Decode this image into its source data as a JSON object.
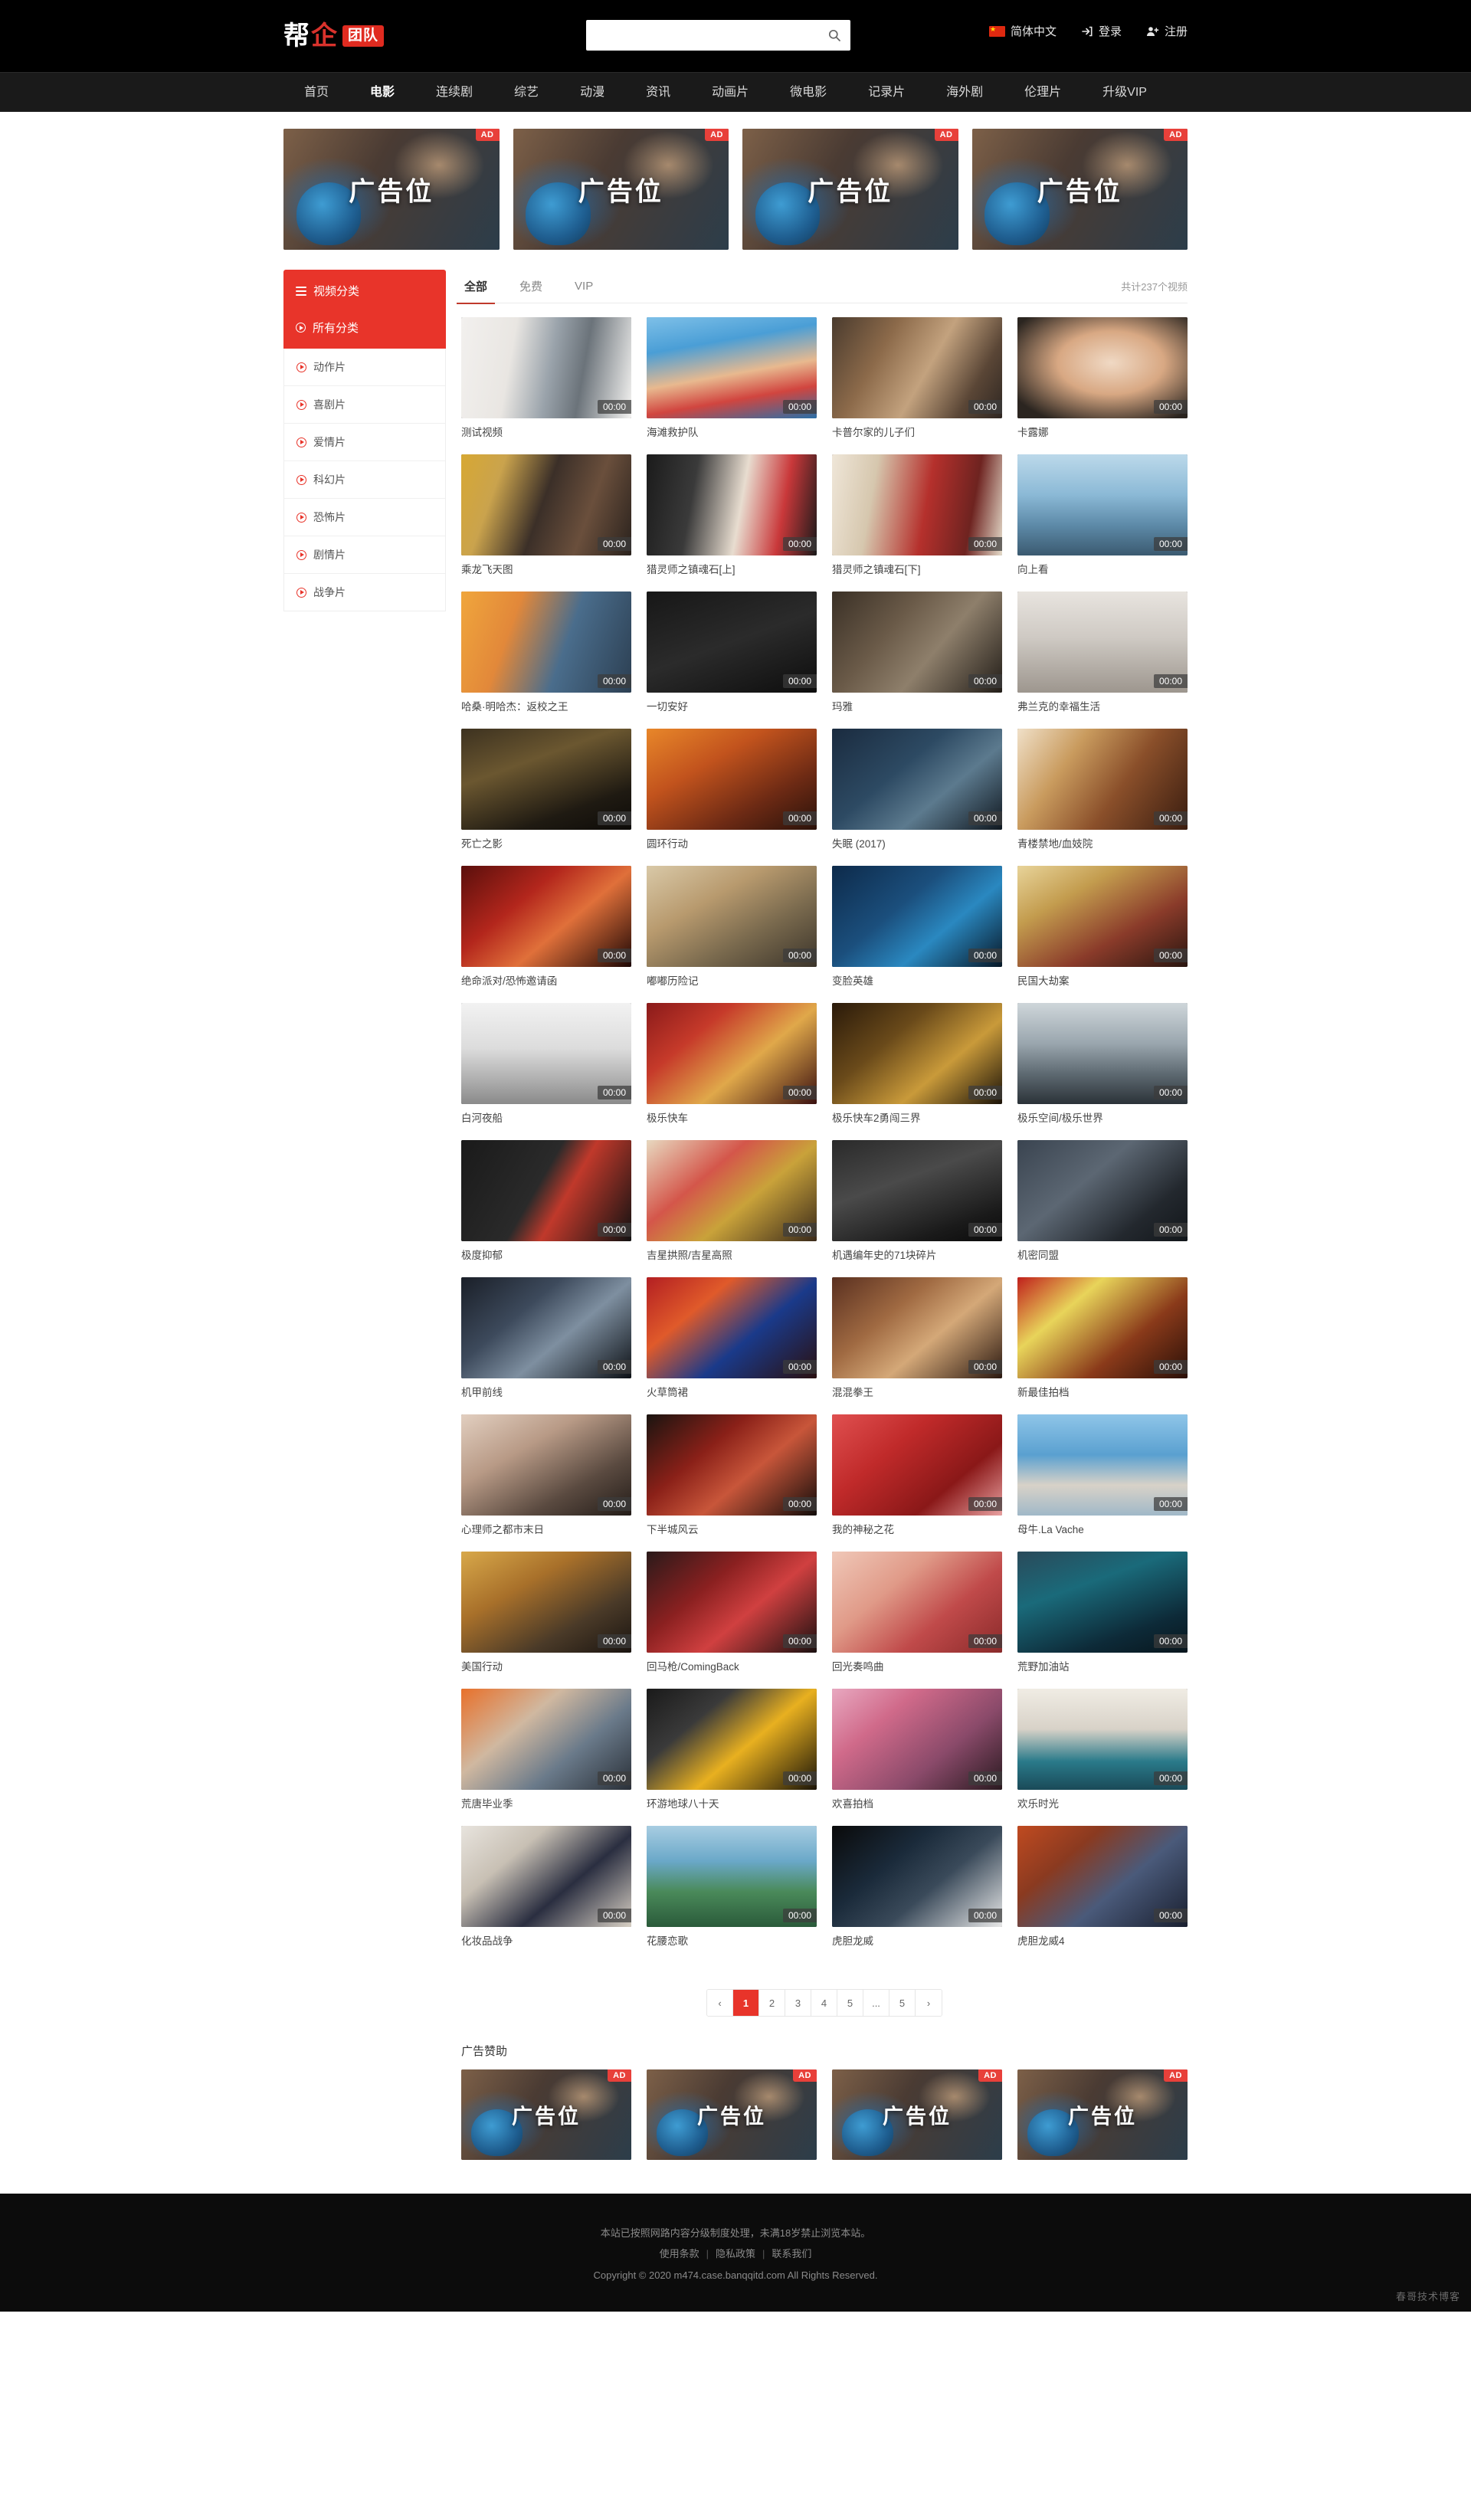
{
  "header": {
    "logo": {
      "part1": "帮",
      "part2": "企",
      "badge": "团队"
    },
    "search": {
      "value": "",
      "placeholder": ""
    },
    "language": "简体中文",
    "login": "登录",
    "register": "注册"
  },
  "nav": {
    "items": [
      {
        "label": "首页",
        "active": false
      },
      {
        "label": "电影",
        "active": true
      },
      {
        "label": "连续剧",
        "active": false
      },
      {
        "label": "综艺",
        "active": false
      },
      {
        "label": "动漫",
        "active": false
      },
      {
        "label": "资讯",
        "active": false
      },
      {
        "label": "动画片",
        "active": false
      },
      {
        "label": "微电影",
        "active": false
      },
      {
        "label": "记录片",
        "active": false
      },
      {
        "label": "海外剧",
        "active": false
      },
      {
        "label": "伦理片",
        "active": false
      },
      {
        "label": "升级VIP",
        "active": false
      }
    ]
  },
  "top_ads": [
    {
      "badge": "AD",
      "text": "广告位"
    },
    {
      "badge": "AD",
      "text": "广告位"
    },
    {
      "badge": "AD",
      "text": "广告位"
    },
    {
      "badge": "AD",
      "text": "广告位"
    }
  ],
  "sidebar": {
    "title": "视频分类",
    "active_item": "所有分类",
    "items": [
      {
        "label": "动作片"
      },
      {
        "label": "喜剧片"
      },
      {
        "label": "爱情片"
      },
      {
        "label": "科幻片"
      },
      {
        "label": "恐怖片"
      },
      {
        "label": "剧情片"
      },
      {
        "label": "战争片"
      }
    ]
  },
  "filter": {
    "tabs": [
      {
        "label": "全部",
        "active": true
      },
      {
        "label": "免费",
        "active": false
      },
      {
        "label": "VIP",
        "active": false
      }
    ],
    "total": "共计237个视频"
  },
  "videos": [
    {
      "title": "测试视频",
      "duration": "00:00",
      "bg": "linear-gradient(100deg,#f2f0ee 0%,#e9e6e2 30%,#9aa3ab 52%,#6b737a 70%,#f4f3f1 100%)"
    },
    {
      "title": "海滩救护队",
      "duration": "00:00",
      "bg": "linear-gradient(170deg,#7ec0e8 0%,#4a9ed6 28%,#e8b98f 55%,#d1453f 75%,#2a6fa8 100%)"
    },
    {
      "title": "卡普尔家的儿子们",
      "duration": "00:00",
      "bg": "linear-gradient(120deg,#4a3b2e 0%,#8c6a4a 30%,#c3a27e 55%,#5a4636 80%,#2f2722 100%)"
    },
    {
      "title": "卡露娜",
      "duration": "00:00",
      "bg": "radial-gradient(ellipse at 55% 45%, #f0d9c4 0%, #d8a883 40%, #2b2520 85%)"
    },
    {
      "title": "乘龙飞天图",
      "duration": "00:00",
      "bg": "linear-gradient(110deg,#d7a833 0%,#caa34d 22%,#3b2f28 48%,#6a4f3c 72%,#2a221d 100%)"
    },
    {
      "title": "猎灵师之镇魂石[上]",
      "duration": "00:00",
      "bg": "linear-gradient(100deg,#1b1b1b 0%,#3a3a3a 28%,#e8ddd0 55%,#c9383a 78%,#1a1a1a 100%)"
    },
    {
      "title": "猎灵师之镇魂石[下]",
      "duration": "00:00",
      "bg": "linear-gradient(100deg,#efe6d8 0%,#d6c7ae 25%,#b5302c 55%,#6e2320 80%,#e5dccb 100%)"
    },
    {
      "title": "向上看",
      "duration": "00:00",
      "bg": "linear-gradient(180deg,#bcd9ea 0%,#8bb9d6 40%,#5d8aa8 70%,#3b5a70 100%)"
    },
    {
      "title": "哈桑·明哈杰：返校之王",
      "duration": "00:00",
      "bg": "linear-gradient(110deg,#f0a63c 0%,#e2883a 30%,#4a6d8c 60%,#2c3f52 100%)"
    },
    {
      "title": "一切安好",
      "duration": "00:00",
      "bg": "linear-gradient(160deg,#171717 0%,#2b2b2b 50%,#0d0d0d 100%)"
    },
    {
      "title": "玛雅",
      "duration": "00:00",
      "bg": "linear-gradient(130deg,#3a3026 0%,#6a5a48 35%,#8e7f6b 60%,#221d18 100%)"
    },
    {
      "title": "弗兰克的幸福生活",
      "duration": "00:00",
      "bg": "linear-gradient(180deg,#e8e4df 0%,#cfcac4 45%,#9d968e 100%)"
    },
    {
      "title": "死亡之影",
      "duration": "00:00",
      "bg": "linear-gradient(160deg,#3d3220 0%,#6b5730 35%,#1f1a12 75%,#0d0b08 100%)"
    },
    {
      "title": "圆环行动",
      "duration": "00:00",
      "bg": "linear-gradient(150deg,#e8872a 0%,#c2531d 35%,#6d2a14 70%,#2a120a 100%)"
    },
    {
      "title": "失眠 (2017)",
      "duration": "00:00",
      "bg": "linear-gradient(140deg,#1a2b3f 0%,#2d4a63 40%,#5c7a8e 65%,#101820 100%)"
    },
    {
      "title": "青楼禁地/血妓院",
      "duration": "00:00",
      "bg": "linear-gradient(125deg,#f0e0c8 0%,#c99b5e 30%,#8a4f2a 60%,#3a1d10 100%)"
    },
    {
      "title": "绝命派对/恐怖邀请函",
      "duration": "00:00",
      "bg": "linear-gradient(140deg,#5a0f0c 0%,#b3261c 35%,#e0703a 60%,#1d0705 100%)"
    },
    {
      "title": "嘟嘟历险记",
      "duration": "00:00",
      "bg": "linear-gradient(150deg,#d9c9a8 0%,#b89a6e 35%,#7a6a4e 65%,#3b342a 100%)"
    },
    {
      "title": "变脸英雄",
      "duration": "00:00",
      "bg": "linear-gradient(140deg,#0d2a4a 0%,#1b4f7d 40%,#2a88c0 65%,#081827 100%)"
    },
    {
      "title": "民国大劫案",
      "duration": "00:00",
      "bg": "linear-gradient(150deg,#e8d49a 0%,#c39c4e 30%,#8a3b2a 65%,#2a1610 100%)"
    },
    {
      "title": "白河夜船",
      "duration": "00:00",
      "bg": "linear-gradient(180deg,#f2f2f2 0%,#dcdcdc 45%,#b0b0b0 75%,#8a8a8a 100%)"
    },
    {
      "title": "极乐快车",
      "duration": "00:00",
      "bg": "linear-gradient(140deg,#8a1a1a 0%,#c63a2a 30%,#e0a84a 60%,#3a1010 100%)"
    },
    {
      "title": "极乐快车2勇闯三界",
      "duration": "00:00",
      "bg": "linear-gradient(140deg,#2a1a0a 0%,#6a4a1a 35%,#c99a3a 65%,#1a1208 100%)"
    },
    {
      "title": "极乐空间/极乐世界",
      "duration": "00:00",
      "bg": "linear-gradient(180deg,#cfd6da 0%,#9aa6ae 40%,#5e6a72 70%,#2b3238 100%)"
    },
    {
      "title": "极度抑郁",
      "duration": "00:00",
      "bg": "linear-gradient(120deg,#1a1a1a 0%,#2a2a2a 45%,#c0392b 60%,#121212 100%)"
    },
    {
      "title": "吉星拱照/吉星高照",
      "duration": "00:00",
      "bg": "linear-gradient(140deg,#e8d9c0 0%,#d4564a 35%,#c9a23a 60%,#3a2a1a 100%)"
    },
    {
      "title": "机遇编年史的71块碎片",
      "duration": "00:00",
      "bg": "linear-gradient(160deg,#2a2a2a 0%,#4a4a4a 40%,#1a1a1a 80%,#0a0a0a 100%)"
    },
    {
      "title": "机密同盟",
      "duration": "00:00",
      "bg": "linear-gradient(140deg,#3a4450 0%,#5c6773 40%,#23282e 75%,#12161a 100%)"
    },
    {
      "title": "机甲前线",
      "duration": "00:00",
      "bg": "linear-gradient(140deg,#1a1f28 0%,#3d4a5c 35%,#7e8fa0 60%,#0d1116 100%)"
    },
    {
      "title": "火草筒裙",
      "duration": "00:00",
      "bg": "linear-gradient(140deg,#b31f22 0%,#e05a2a 30%,#1a3a8a 60%,#2a1010 100%)"
    },
    {
      "title": "混混拳王",
      "duration": "00:00",
      "bg": "linear-gradient(140deg,#5a3020 0%,#a06a42 35%,#d4a878 60%,#2a1810 100%)"
    },
    {
      "title": "新最佳拍档",
      "duration": "00:00",
      "bg": "linear-gradient(140deg,#c0201c 0%,#e8d45a 30%,#8a3a1a 65%,#2a1008 100%)"
    },
    {
      "title": "心理师之都市末日",
      "duration": "00:00",
      "bg": "linear-gradient(150deg,#e2cfc0 0%,#b89a86 35%,#5a4a40 70%,#231c18 100%)"
    },
    {
      "title": "下半城风云",
      "duration": "00:00",
      "bg": "linear-gradient(140deg,#1a1410 0%,#8a2018 35%,#c8563a 60%,#120c0a 100%)"
    },
    {
      "title": "我的神秘之花",
      "duration": "00:00",
      "bg": "linear-gradient(140deg,#e05050 0%,#c02a2a 35%,#8a1818 70%,#e8a0a0 100%)"
    },
    {
      "title": "母牛.La Vache",
      "duration": "00:00",
      "bg": "linear-gradient(180deg,#8fc5e8 0%,#5aa0d0 40%,#d8d2c8 70%,#a0b8c8 100%)"
    },
    {
      "title": "美国行动",
      "duration": "00:00",
      "bg": "linear-gradient(150deg,#d8a84a 0%,#a8702a 35%,#4a3a28 70%,#1a1410 100%)"
    },
    {
      "title": "回马枪/ComingBack",
      "duration": "00:00",
      "bg": "linear-gradient(140deg,#2a1a1a 0%,#8a2020 35%,#d04040 60%,#1a1010 100%)"
    },
    {
      "title": "回光奏鸣曲",
      "duration": "00:00",
      "bg": "linear-gradient(140deg,#f0c8b8 0%,#e09a88 35%,#c04a4a 65%,#8a2a2a 100%)"
    },
    {
      "title": "荒野加油站",
      "duration": "00:00",
      "bg": "linear-gradient(160deg,#2a4a5a 0%,#1a6a7a 35%,#0d2a38 75%,#08161d 100%)"
    },
    {
      "title": "荒唐毕业季",
      "duration": "00:00",
      "bg": "linear-gradient(140deg,#e8702a 0%,#d0b8a0 35%,#6a7a8a 65%,#2a3038 100%)"
    },
    {
      "title": "环游地球八十天",
      "duration": "00:00",
      "bg": "linear-gradient(140deg,#1a1a1a 0%,#3a3a3a 30%,#e8b020 58%,#1a1408 100%)"
    },
    {
      "title": "欢喜拍档",
      "duration": "00:00",
      "bg": "linear-gradient(140deg,#e8a8c0 0%,#d06a8a 30%,#8a4a6a 65%,#2a1a20 100%)"
    },
    {
      "title": "欢乐时光",
      "duration": "00:00",
      "bg": "linear-gradient(180deg,#f0ece4 0%,#d8d2c8 40%,#2a7a8a 72%,#1a4a58 100%)"
    },
    {
      "title": "化妆品战争",
      "duration": "00:00",
      "bg": "linear-gradient(140deg,#e8e4de 0%,#c8c0b4 30%,#2a2e40 62%,#d8d0c4 100%)"
    },
    {
      "title": "花腰恋歌",
      "duration": "00:00",
      "bg": "linear-gradient(180deg,#a8cde2 0%,#6aa8c8 35%,#4a8a5a 65%,#2a5a3a 100%)"
    },
    {
      "title": "虎胆龙威",
      "duration": "00:00",
      "bg": "linear-gradient(140deg,#0a0a0a 0%,#1a2a3a 35%,#3a4a5a 60%,#e8e8e8 100%)"
    },
    {
      "title": "虎胆龙威4",
      "duration": "00:00",
      "bg": "linear-gradient(140deg,#c04a20 0%,#8a3a20 30%,#4a5a7a 60%,#1a2030 100%)"
    }
  ],
  "pagination": {
    "prev": "‹",
    "next": "›",
    "pages": [
      "1",
      "2",
      "3",
      "4",
      "5",
      "...",
      "5"
    ],
    "current": "1"
  },
  "sponsor": {
    "title": "广告赞助",
    "ads": [
      {
        "badge": "AD",
        "text": "广告位"
      },
      {
        "badge": "AD",
        "text": "广告位"
      },
      {
        "badge": "AD",
        "text": "广告位"
      },
      {
        "badge": "AD",
        "text": "广告位"
      }
    ]
  },
  "footer": {
    "notice": "本站已按照网路内容分级制度处理，未满18岁禁止浏览本站。",
    "links": [
      "使用条款",
      "隐私政策",
      "联系我们"
    ],
    "copyright": "Copyright © 2020 m474.case.banqqitd.com All Rights Reserved.",
    "watermark": "春哥技术博客"
  }
}
